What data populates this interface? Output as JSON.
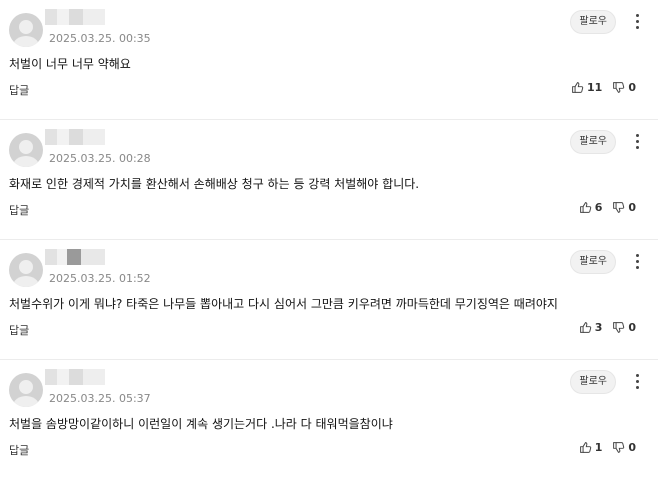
{
  "comments": [
    {
      "timestamp": "2025.03.25. 00:35",
      "follow_label": "팔로우",
      "text": "처벌이 너무 너무 약해요",
      "reply_label": "답글",
      "likes": "11",
      "dislikes": "0"
    },
    {
      "timestamp": "2025.03.25. 00:28",
      "follow_label": "팔로우",
      "text": "화재로 인한 경제적 가치를 환산해서 손해배상 청구 하는 등 강력 처벌해야 합니다.",
      "reply_label": "답글",
      "likes": "6",
      "dislikes": "0"
    },
    {
      "timestamp": "2025.03.25. 01:52",
      "follow_label": "팔로우",
      "text": "처벌수위가 이게 뭐냐? 타죽은 나무들 뽑아내고 다시 심어서 그만큼 키우려면 까마득한데 무기징역은 때려야지",
      "reply_label": "답글",
      "likes": "3",
      "dislikes": "0"
    },
    {
      "timestamp": "2025.03.25. 05:37",
      "follow_label": "팔로우",
      "text": "처벌을 솜방망이같이하니 이런일이 계속 생기는거다 .나라 다 태워먹을참이냐",
      "reply_label": "답글",
      "likes": "1",
      "dislikes": "0"
    }
  ],
  "icons": {
    "like": "thumbs-up-icon",
    "dislike": "thumbs-down-icon",
    "more": "more-vertical-icon",
    "avatar": "default-avatar-icon"
  }
}
